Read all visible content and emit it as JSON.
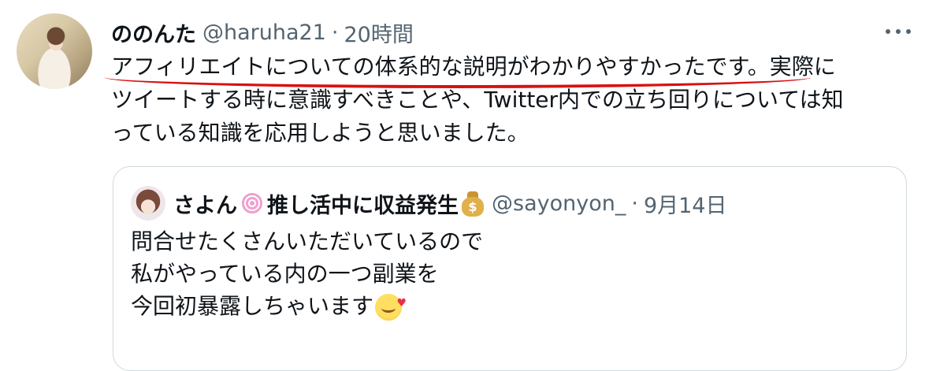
{
  "tweet": {
    "display_name": "ののんた",
    "handle": "@haruha21",
    "separator": "·",
    "time": "20時間",
    "lines": [
      "アフィリエイトについての体系的な説明がわかりやすかったです。実際に",
      "ツイートする時に意識すべきことや、Twitter内での立ち回りについては知",
      "っている知識を応用しようと思いました。"
    ],
    "underline_color": "#d81111"
  },
  "quote": {
    "display_name": "さよん",
    "name_suffix": "推し活中に収益発生",
    "moneybag_symbol": "$",
    "handle": "@sayonyon_",
    "separator": "·",
    "time": "9月14日",
    "lines": [
      "問合せたくさんいただいているので",
      "私がやっている内の一つ副業を",
      "今回初暴露しちゃいます"
    ]
  },
  "icons": [
    "more-icon",
    "spiral-icon",
    "moneybag-icon",
    "smiling-face-with-hearts-icon"
  ],
  "colors": {
    "text": "#0f1419",
    "secondary": "#536471",
    "border": "#cfd9de"
  }
}
